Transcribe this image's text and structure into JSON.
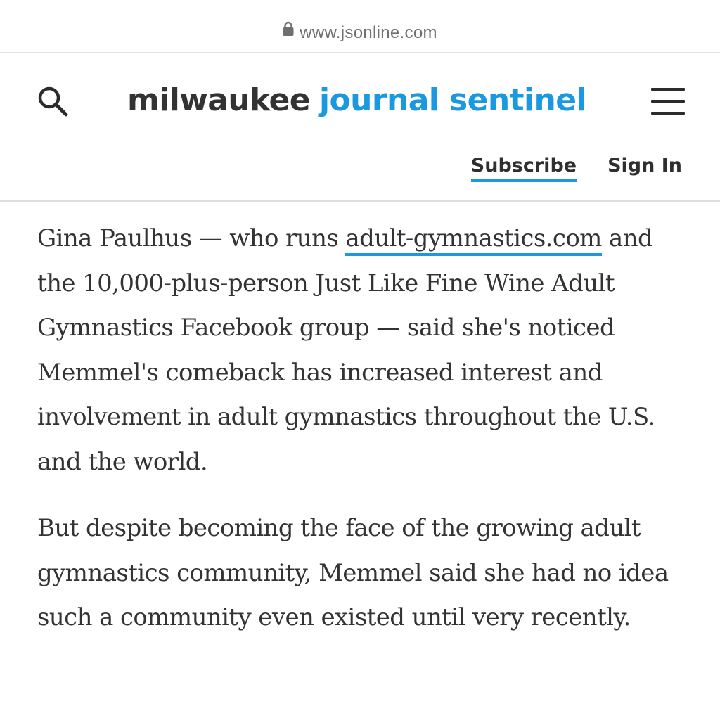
{
  "browser": {
    "url": "www.jsonline.com",
    "lock_icon": "lock-icon"
  },
  "header": {
    "search_icon": "search-icon",
    "logo_part1": "milwaukee",
    "logo_part2": "journal sentinel",
    "menu_icon": "hamburger-menu-icon",
    "subscribe_label": "Subscribe",
    "signin_label": "Sign In"
  },
  "article": {
    "paragraph1": {
      "before_link": "Gina Paulhus — who runs ",
      "link_text": "adult-gymnastics.com",
      "after_link": " and the 10,000-plus-person Just Like Fine Wine Adult Gymnastics Facebook group — said she's noticed Memmel's comeback has increased interest and involvement in adult gymnastics throughout the U.S. and the world."
    },
    "paragraph2": "But despite becoming the face of the growing adult gymnastics community, Memmel said she had no idea such a community even existed until very recently."
  },
  "colors": {
    "brand_blue": "#1a98e0",
    "text_dark": "#333333",
    "url_gray": "#6f6f6f"
  }
}
